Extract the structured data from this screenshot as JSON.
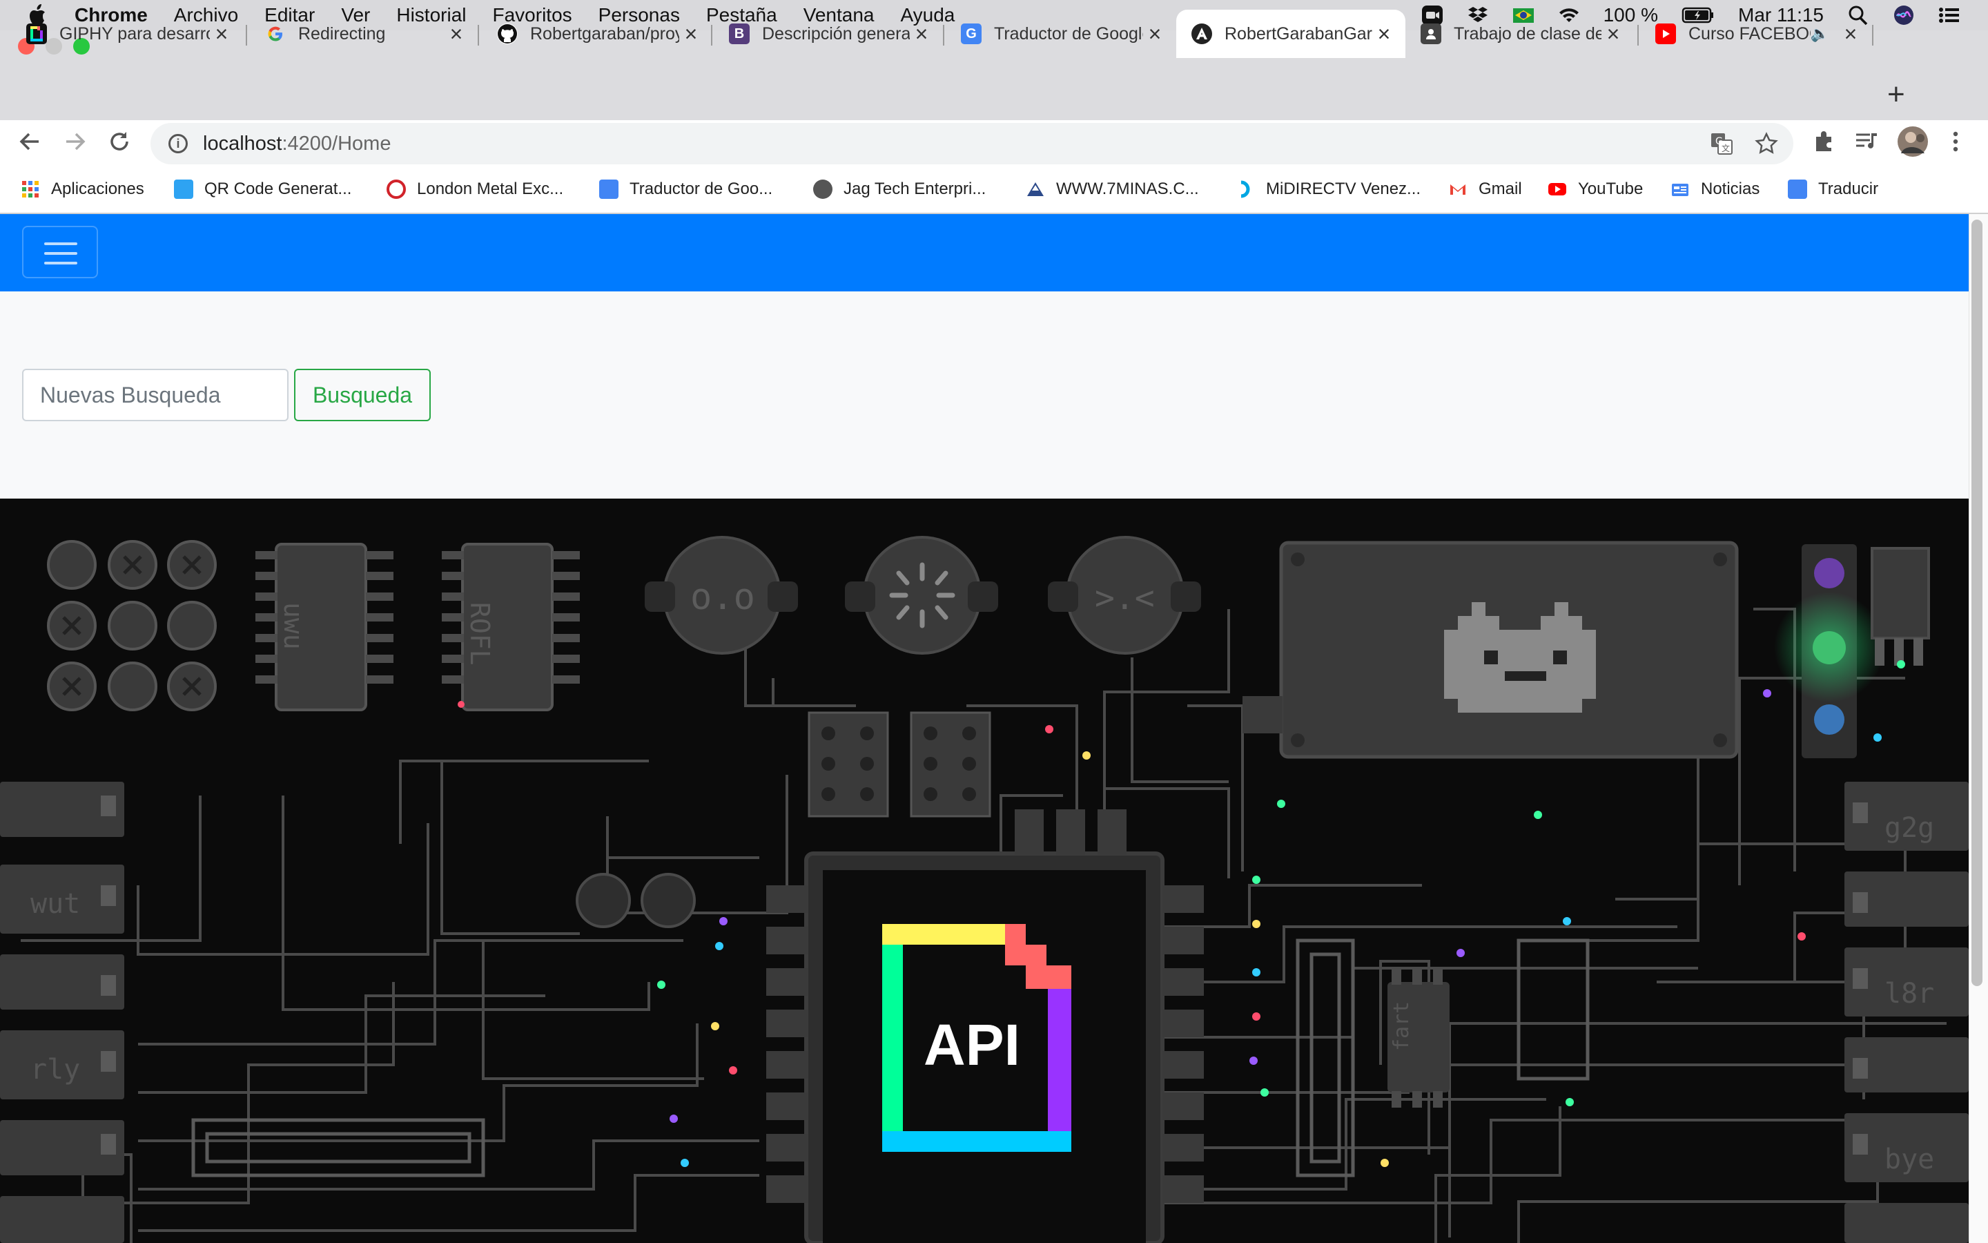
{
  "menubar": {
    "app": "Chrome",
    "items": [
      "Archivo",
      "Editar",
      "Ver",
      "Historial",
      "Favoritos",
      "Personas",
      "Pestaña",
      "Ventana",
      "Ayuda"
    ],
    "battery": "100 %",
    "clock": "Mar 11:15",
    "status_icons": [
      "zoom-icon",
      "dropbox-icon",
      "flag-icon",
      "wifi-icon",
      "battery-icon",
      "spotlight-icon",
      "siri-icon",
      "control-center-icon"
    ]
  },
  "tabs": [
    {
      "title": "GIPHY para desarrolladores",
      "icon": "giphy-icon",
      "color": "#222222"
    },
    {
      "title": "Redirecting",
      "icon": "google-icon",
      "color": "#4285f4"
    },
    {
      "title": "Robertgaraban/proyecto",
      "icon": "github-icon",
      "color": "#111111"
    },
    {
      "title": "Descripción general",
      "icon": "bootstrap-icon",
      "color": "#563d7c"
    },
    {
      "title": "Traductor de Google",
      "icon": "translate-icon",
      "color": "#4285f4"
    },
    {
      "title": "RobertGarabanGaraban",
      "icon": "angular-icon",
      "color": "#222222"
    },
    {
      "title": "Trabajo de clase de",
      "icon": "classroom-icon",
      "color": "#444444"
    },
    {
      "title": "Curso FACEBOOK",
      "icon": "youtube-icon",
      "color": "#ff0000"
    }
  ],
  "toolbar": {
    "url_host": "localhost",
    "url_path": ":4200/Home"
  },
  "bookmarks": [
    {
      "label": "Aplicaciones",
      "icon": "apps-grid-icon",
      "color": "#ea4335"
    },
    {
      "label": "QR Code Generat...",
      "icon": "qr-icon",
      "color": "#2ea3f2"
    },
    {
      "label": "London Metal Exc...",
      "icon": "lme-icon",
      "color": "#d1232a"
    },
    {
      "label": "Traductor de Goo...",
      "icon": "translate-icon",
      "color": "#4285f4"
    },
    {
      "label": "Jag Tech Enterpri...",
      "icon": "globe-icon",
      "color": "#555555"
    },
    {
      "label": "WWW.7MINAS.C...",
      "icon": "mountain-icon",
      "color": "#2c4a8a"
    },
    {
      "label": "MiDIRECTV Venez...",
      "icon": "directv-icon",
      "color": "#00a6e2"
    },
    {
      "label": "Gmail",
      "icon": "gmail-icon",
      "color": "#ea4335"
    },
    {
      "label": "YouTube",
      "icon": "youtube-icon",
      "color": "#ff0000"
    },
    {
      "label": "Noticias",
      "icon": "news-icon",
      "color": "#4285f4"
    },
    {
      "label": "Traducir",
      "icon": "translate-icon",
      "color": "#4285f4"
    }
  ],
  "page": {
    "search_placeholder": "Nuevas Busqueda",
    "search_button": "Busqueda",
    "navbar_color": "#007bff",
    "button_color": "#28a745",
    "hero": {
      "chips": [
        "o.o",
        "ROFL",
        ">.<",
        "uwu",
        "fart",
        "g2g",
        "wut",
        "l8r",
        "rly",
        "bye"
      ],
      "center_label": "API"
    }
  }
}
